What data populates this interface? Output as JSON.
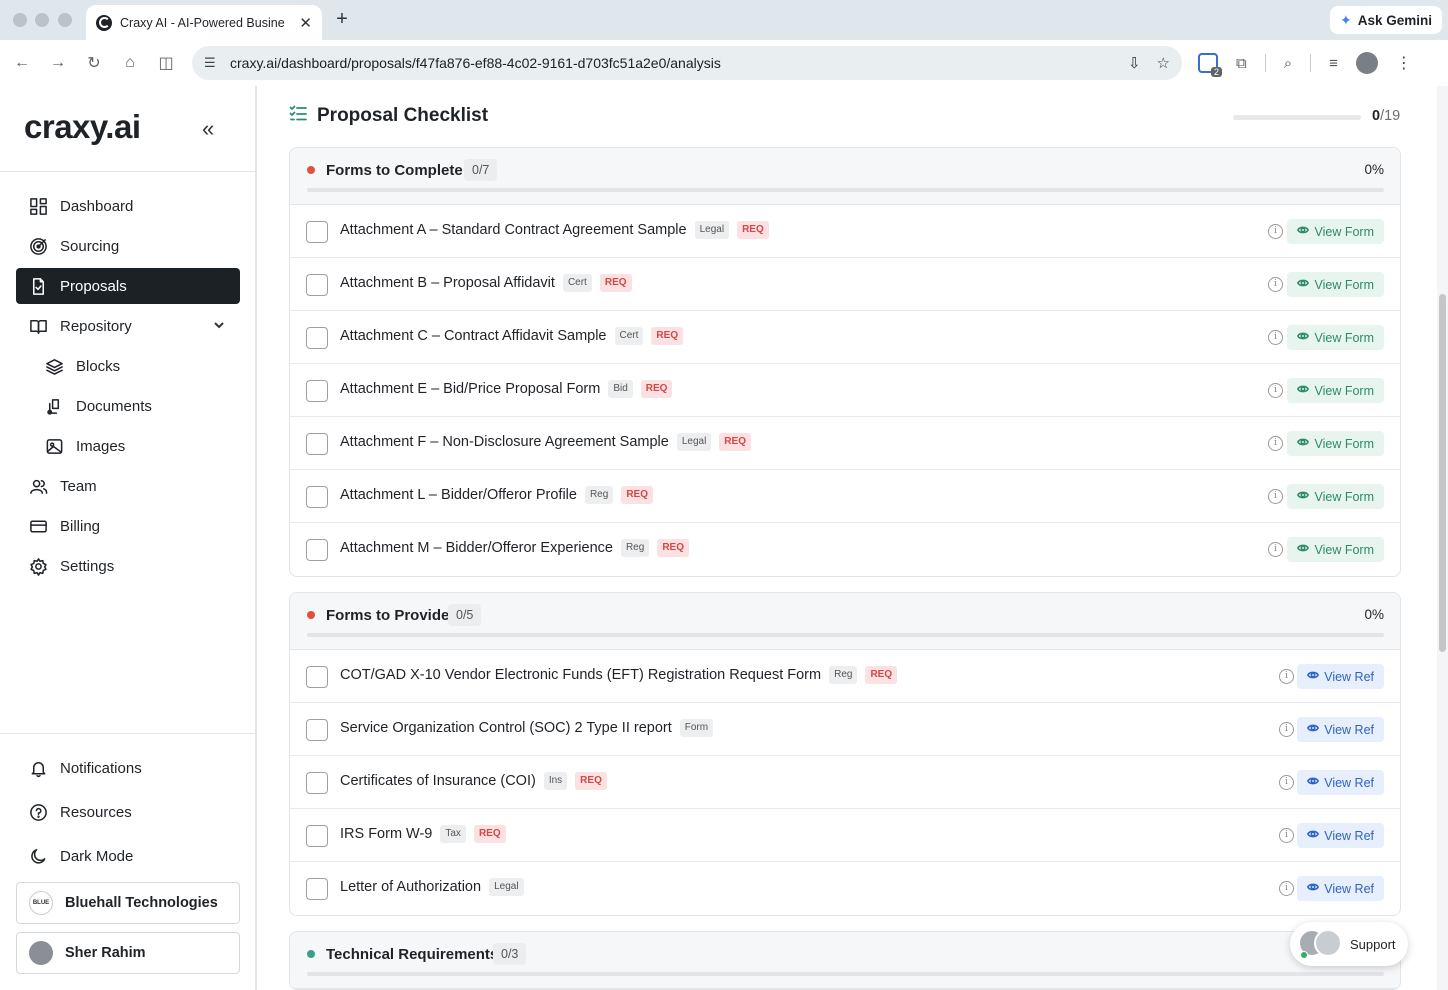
{
  "browser": {
    "tab_title": "Craxy AI - AI-Powered Busine",
    "url": "craxy.ai/dashboard/proposals/f47fa876-ef88-4c02-9161-d703fc51a2e0/analysis",
    "gemini_label": "Ask Gemini",
    "extension_badge": "2"
  },
  "sidebar": {
    "logo": "craxy.ai",
    "nav": [
      {
        "label": "Dashboard",
        "icon": "dashboard-icon"
      },
      {
        "label": "Sourcing",
        "icon": "target-icon"
      },
      {
        "label": "Proposals",
        "icon": "file-check-icon",
        "active": true
      },
      {
        "label": "Repository",
        "icon": "book-icon"
      },
      {
        "label": "Blocks",
        "icon": "layers-icon"
      },
      {
        "label": "Documents",
        "icon": "documents-icon"
      },
      {
        "label": "Images",
        "icon": "image-icon"
      },
      {
        "label": "Team",
        "icon": "users-icon"
      },
      {
        "label": "Billing",
        "icon": "card-icon"
      },
      {
        "label": "Settings",
        "icon": "gear-icon"
      }
    ],
    "bottom": [
      {
        "label": "Notifications",
        "icon": "bell-icon"
      },
      {
        "label": "Resources",
        "icon": "help-icon"
      },
      {
        "label": "Dark Mode",
        "icon": "moon-icon"
      }
    ],
    "org_name": "Bluehall Technologies",
    "org_logo_text": "BLUE",
    "user_name": "Sher Rahim"
  },
  "checklist": {
    "title": "Proposal Checklist",
    "done": "0",
    "total": "/19",
    "progress": 0
  },
  "sections": [
    {
      "title": "Forms to Complete",
      "count": "0/7",
      "pct": "0%",
      "dot_color": "#e0523f",
      "button": "View Form",
      "items": [
        {
          "title": "Attachment A – Standard Contract Agreement Sample",
          "tags": [
            "Legal",
            "REQ"
          ]
        },
        {
          "title": "Attachment B – Proposal Affidavit",
          "tags": [
            "Cert",
            "REQ"
          ]
        },
        {
          "title": "Attachment C – Contract Affidavit Sample",
          "tags": [
            "Cert",
            "REQ"
          ]
        },
        {
          "title": "Attachment E – Bid/Price Proposal Form",
          "tags": [
            "Bid",
            "REQ"
          ]
        },
        {
          "title": "Attachment F – Non-Disclosure Agreement Sample",
          "tags": [
            "Legal",
            "REQ"
          ]
        },
        {
          "title": "Attachment L – Bidder/Offeror Profile",
          "tags": [
            "Reg",
            "REQ"
          ]
        },
        {
          "title": "Attachment M – Bidder/Offeror Experience",
          "tags": [
            "Reg",
            "REQ"
          ]
        }
      ]
    },
    {
      "title": "Forms to Provide",
      "count": "0/5",
      "pct": "0%",
      "dot_color": "#e0523f",
      "button": "View Ref",
      "items": [
        {
          "title": "COT/GAD X-10 Vendor Electronic Funds (EFT) Registration Request Form",
          "tags": [
            "Reg",
            "REQ"
          ]
        },
        {
          "title": "Service Organization Control (SOC) 2 Type II report",
          "tags": [
            "Form"
          ]
        },
        {
          "title": "Certificates of Insurance (COI)",
          "tags": [
            "Ins",
            "REQ"
          ]
        },
        {
          "title": "IRS Form W-9",
          "tags": [
            "Tax",
            "REQ"
          ]
        },
        {
          "title": "Letter of Authorization",
          "tags": [
            "Legal"
          ]
        }
      ]
    },
    {
      "title": "Technical Requirements",
      "count": "0/3",
      "pct": "",
      "dot_color": "#3aa08a",
      "button": "",
      "items": []
    }
  ],
  "support_label": "Support",
  "colors": {
    "accent": "#2d8a7a",
    "active_nav": "#1c2126",
    "req": "#d04848"
  }
}
